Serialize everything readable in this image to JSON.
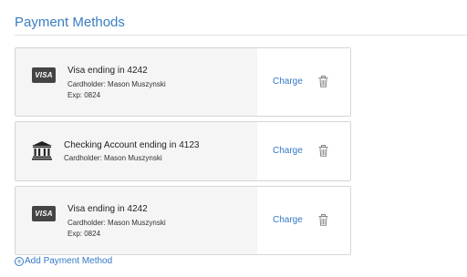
{
  "header": {
    "title": "Payment Methods"
  },
  "methods": [
    {
      "icon": "visa-card-icon",
      "brand_label": "VISA",
      "title": "Visa ending in 4242",
      "cardholder": "Cardholder: Mason Muszynski",
      "exp": "Exp: 0824",
      "charge_label": "Charge"
    },
    {
      "icon": "bank-icon",
      "title": "Checking Account ending in 4123",
      "cardholder": "Cardholder: Mason Muszynski",
      "charge_label": "Charge"
    },
    {
      "icon": "visa-card-icon",
      "brand_label": "VISA",
      "title": "Visa ending in 4242",
      "cardholder": "Cardholder: Mason Muszynski",
      "exp": "Exp: 0824",
      "charge_label": "Charge"
    }
  ],
  "footer": {
    "add_label": "Add Payment Method",
    "add_icon": "plus-circle-icon"
  },
  "colors": {
    "accent": "#3478c6",
    "heading": "#3b7ec1",
    "card_bg": "#f5f5f5",
    "border": "#d2d6db"
  }
}
